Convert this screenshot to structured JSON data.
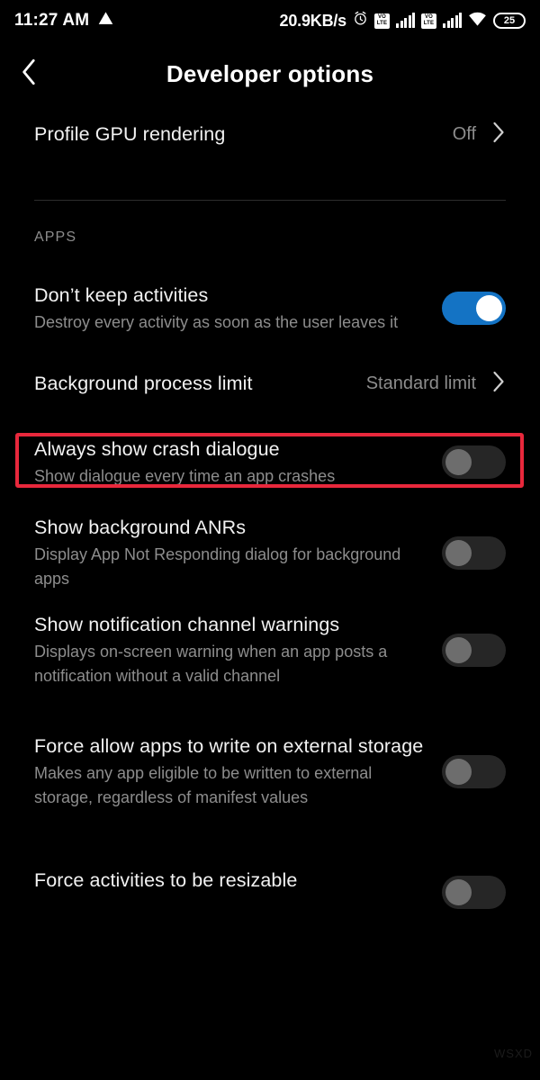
{
  "status_bar": {
    "time": "11:27 AM",
    "warning_icon": "warning-triangle-icon",
    "network_speed": "20.9KB/s",
    "alarm_icon": "alarm-clock-icon",
    "volte_label_top": "VO",
    "volte_label_bottom": "LTE",
    "wifi_icon": "wifi-icon",
    "battery_level": "25"
  },
  "app_bar": {
    "back_icon": "chevron-left-icon",
    "title": "Developer options"
  },
  "top_row": {
    "title": "Profile GPU rendering",
    "value": "Off",
    "chevron_icon": "chevron-right-icon"
  },
  "section": {
    "label": "APPS"
  },
  "rows": [
    {
      "title": "Don’t keep activities",
      "subtitle": "Destroy every activity as soon as the user leaves it",
      "control": "toggle",
      "state": "on"
    },
    {
      "title": "Background process limit",
      "subtitle": "",
      "control": "value-chevron",
      "value": "Standard limit",
      "highlighted": "true"
    },
    {
      "title": "Always show crash dialogue",
      "subtitle": "Show dialogue every time an app crashes",
      "control": "toggle",
      "state": "off"
    },
    {
      "title": "Show background ANRs",
      "subtitle": "Display App Not Responding dialog for background apps",
      "control": "toggle",
      "state": "off"
    },
    {
      "title": "Show notification channel warnings",
      "subtitle": "Displays on-screen warning when an app posts a notification without a valid channel",
      "control": "toggle",
      "state": "off"
    },
    {
      "title": "Force allow apps to write on external storage",
      "subtitle": "Makes any app eligible to be written to external storage, regardless of manifest values",
      "control": "toggle",
      "state": "off"
    },
    {
      "title": "Force activities to be resizable",
      "subtitle": "",
      "control": "toggle",
      "state": "off"
    }
  ],
  "colors": {
    "background": "#000000",
    "accent_toggle_on": "#1473c4",
    "highlight_border": "#e8283c",
    "primary_text": "#f2f2f2",
    "secondary_text": "#8d8d8d"
  },
  "watermark": "WSXD"
}
